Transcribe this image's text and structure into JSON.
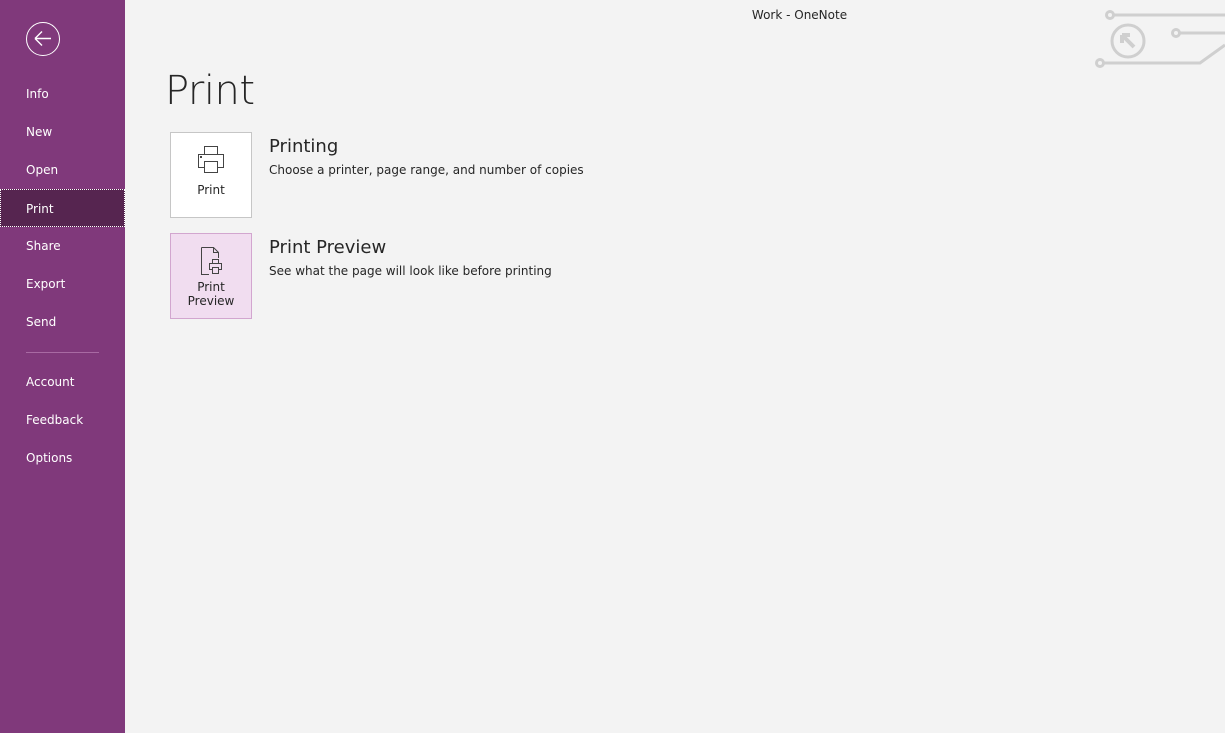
{
  "window": {
    "title": "Work  -  OneNote"
  },
  "colors": {
    "sidebar": "#80397b",
    "sidebar_selected": "#562550",
    "accent_tile": "#f1ddf0"
  },
  "sidebar": {
    "back_icon": "back-arrow-icon",
    "items": [
      {
        "label": "Info"
      },
      {
        "label": "New"
      },
      {
        "label": "Open"
      },
      {
        "label": "Print",
        "selected": true
      },
      {
        "label": "Share"
      },
      {
        "label": "Export"
      },
      {
        "label": "Send"
      },
      {
        "label": "Account"
      },
      {
        "label": "Feedback"
      },
      {
        "label": "Options"
      }
    ]
  },
  "main": {
    "title": "Print",
    "options": [
      {
        "tile_label": "Print",
        "heading": "Printing",
        "description": "Choose a printer, page range, and number of copies",
        "icon": "printer-icon"
      },
      {
        "tile_label_1": "Print",
        "tile_label_2": "Preview",
        "heading": "Print Preview",
        "description": "See what the page will look like before printing",
        "icon": "print-preview-icon",
        "selected": true
      }
    ]
  }
}
